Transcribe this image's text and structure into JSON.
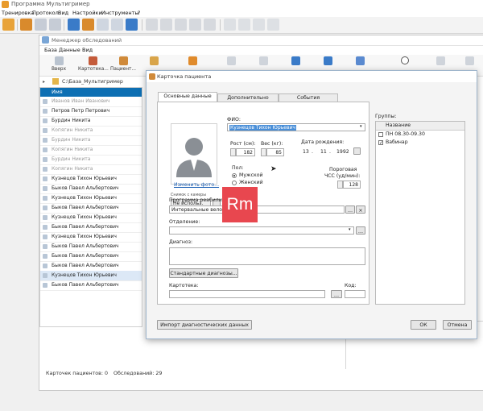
{
  "app": {
    "title": "Программа Мультигример",
    "menu": [
      "Тренировка",
      "Протокол",
      "Вид",
      "Настройки",
      "Инструменты",
      "?"
    ]
  },
  "manager": {
    "title": "Менеджер обследований",
    "menu": [
      "База",
      "Данные",
      "Вид"
    ],
    "toolbar": [
      "Вверх",
      "Картотека...",
      "Пациент...",
      "",
      "",
      "",
      "",
      "",
      "",
      "",
      "",
      "",
      ""
    ],
    "path": "C:\\База_Мультигример",
    "list_header": "Имя",
    "patients": [
      {
        "name": "Иванов Иван Иванович",
        "gray": true
      },
      {
        "name": "Петров Петр Петрович",
        "gray": false
      },
      {
        "name": "Бурдин Никита",
        "gray": false
      },
      {
        "name": "Копягин Никита",
        "gray": true
      },
      {
        "name": "Бурдин Никита",
        "gray": true
      },
      {
        "name": "Копягин Никита",
        "gray": true
      },
      {
        "name": "Бурдин Никита",
        "gray": true
      },
      {
        "name": "Копягин Никита",
        "gray": true
      },
      {
        "name": "Кузнецов Тихон Юрьевич",
        "gray": false
      },
      {
        "name": "Быков Павел Альбертович",
        "gray": false
      },
      {
        "name": "Кузнецов Тихон Юрьевич",
        "gray": false
      },
      {
        "name": "Быков Павел Альбертович",
        "gray": false
      },
      {
        "name": "Кузнецов Тихон Юрьевич",
        "gray": false
      },
      {
        "name": "Быков Павел Альбертович",
        "gray": false
      },
      {
        "name": "Кузнецов Тихон Юрьевич",
        "gray": false
      },
      {
        "name": "Быков Павел Альбертович",
        "gray": false
      },
      {
        "name": "Быков Павел Альбертович",
        "gray": false
      },
      {
        "name": "Быков Павел Альбертович",
        "gray": false
      },
      {
        "name": "Кузнецов Тихон Юрьевич",
        "gray": false
      },
      {
        "name": "Быков Павел Альбертович",
        "gray": false
      }
    ],
    "status_patients": "Карточек пациентов: 0",
    "status_exams": "Обследований: 29"
  },
  "dialog": {
    "title": "Карточка пациента",
    "tabs": [
      "Основные данные",
      "Дополнительно",
      "События"
    ],
    "fio_label": "ФИО:",
    "fio_value": "Кузнецов Тихон Юрьевич",
    "change_photo": "Изменить фото...",
    "camera_label": "Снимок с камеры",
    "camera_value": "Не использ.",
    "height_label": "Рост (см):",
    "height_value": "182",
    "weight_label": "Вес (кг):",
    "weight_value": "85",
    "birth_label": "Дата рождения:",
    "birth_day": "13",
    "birth_month": "11",
    "birth_year": "1992",
    "sex_label": "Пол:",
    "sex_male": "Мужской",
    "sex_female": "Женский",
    "hr_label1": "Пороговая",
    "hr_label2": "ЧСС (уд/мин):",
    "hr_value": "128",
    "program_label": "Программа реабилитации:",
    "program_value": "Интервальные вело",
    "dept_label": "Отделение:",
    "diag_label": "Диагноз:",
    "std_diag_button": "Стандартные диагнозы...",
    "card_label": "Картотека:",
    "code_label": "Код:",
    "groups_label": "Группы:",
    "groups_header": "Название",
    "groups": [
      {
        "name": "ПН 08.30-09.30",
        "checked": false
      },
      {
        "name": "Вабинар",
        "checked": true
      }
    ],
    "import_button": "Импорт диагностических данных",
    "ok_button": "ОК",
    "cancel_button": "Отмена"
  },
  "logo_text": "Rm",
  "colors": {
    "accent": "#0d6fb3",
    "selection": "#4a8fd8",
    "logo": "#e8474f"
  }
}
